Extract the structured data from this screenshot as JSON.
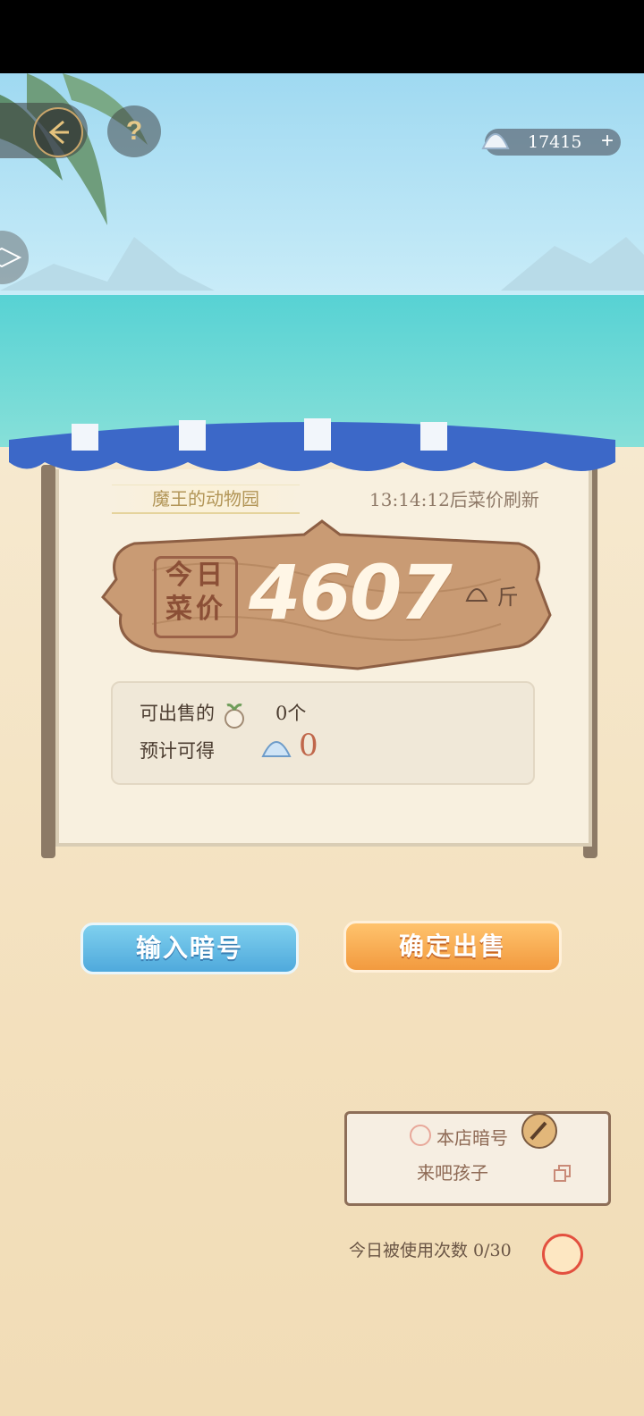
{
  "header": {
    "currency_value": "17415",
    "currency_plus": "+",
    "help_label": "?"
  },
  "stall": {
    "shop_name": "魔王的动物园",
    "refresh_text": "13:14:12后菜价刷新",
    "price_label_line1": "今日",
    "price_label_line2": "菜价",
    "price_value": "4607",
    "unit": "斤"
  },
  "info": {
    "sellable_label": "可出售的",
    "sellable_value": "0个",
    "expected_label": "预计可得",
    "expected_value": "0"
  },
  "actions": {
    "enter_code": "输入暗号",
    "confirm_sell": "确定出售"
  },
  "shop_code": {
    "title": "本店暗号",
    "code": "来吧孩子",
    "usage_text": "今日被使用次数 0/30"
  },
  "colors": {
    "sky": "#9fd9f1",
    "sea": "#57d2d4",
    "sand": "#f3e0bd",
    "awning_blue": "#3c68c8",
    "code_button": "#4fa9dc",
    "sell_button": "#f29a3f",
    "price_plank": "#c99b74"
  }
}
